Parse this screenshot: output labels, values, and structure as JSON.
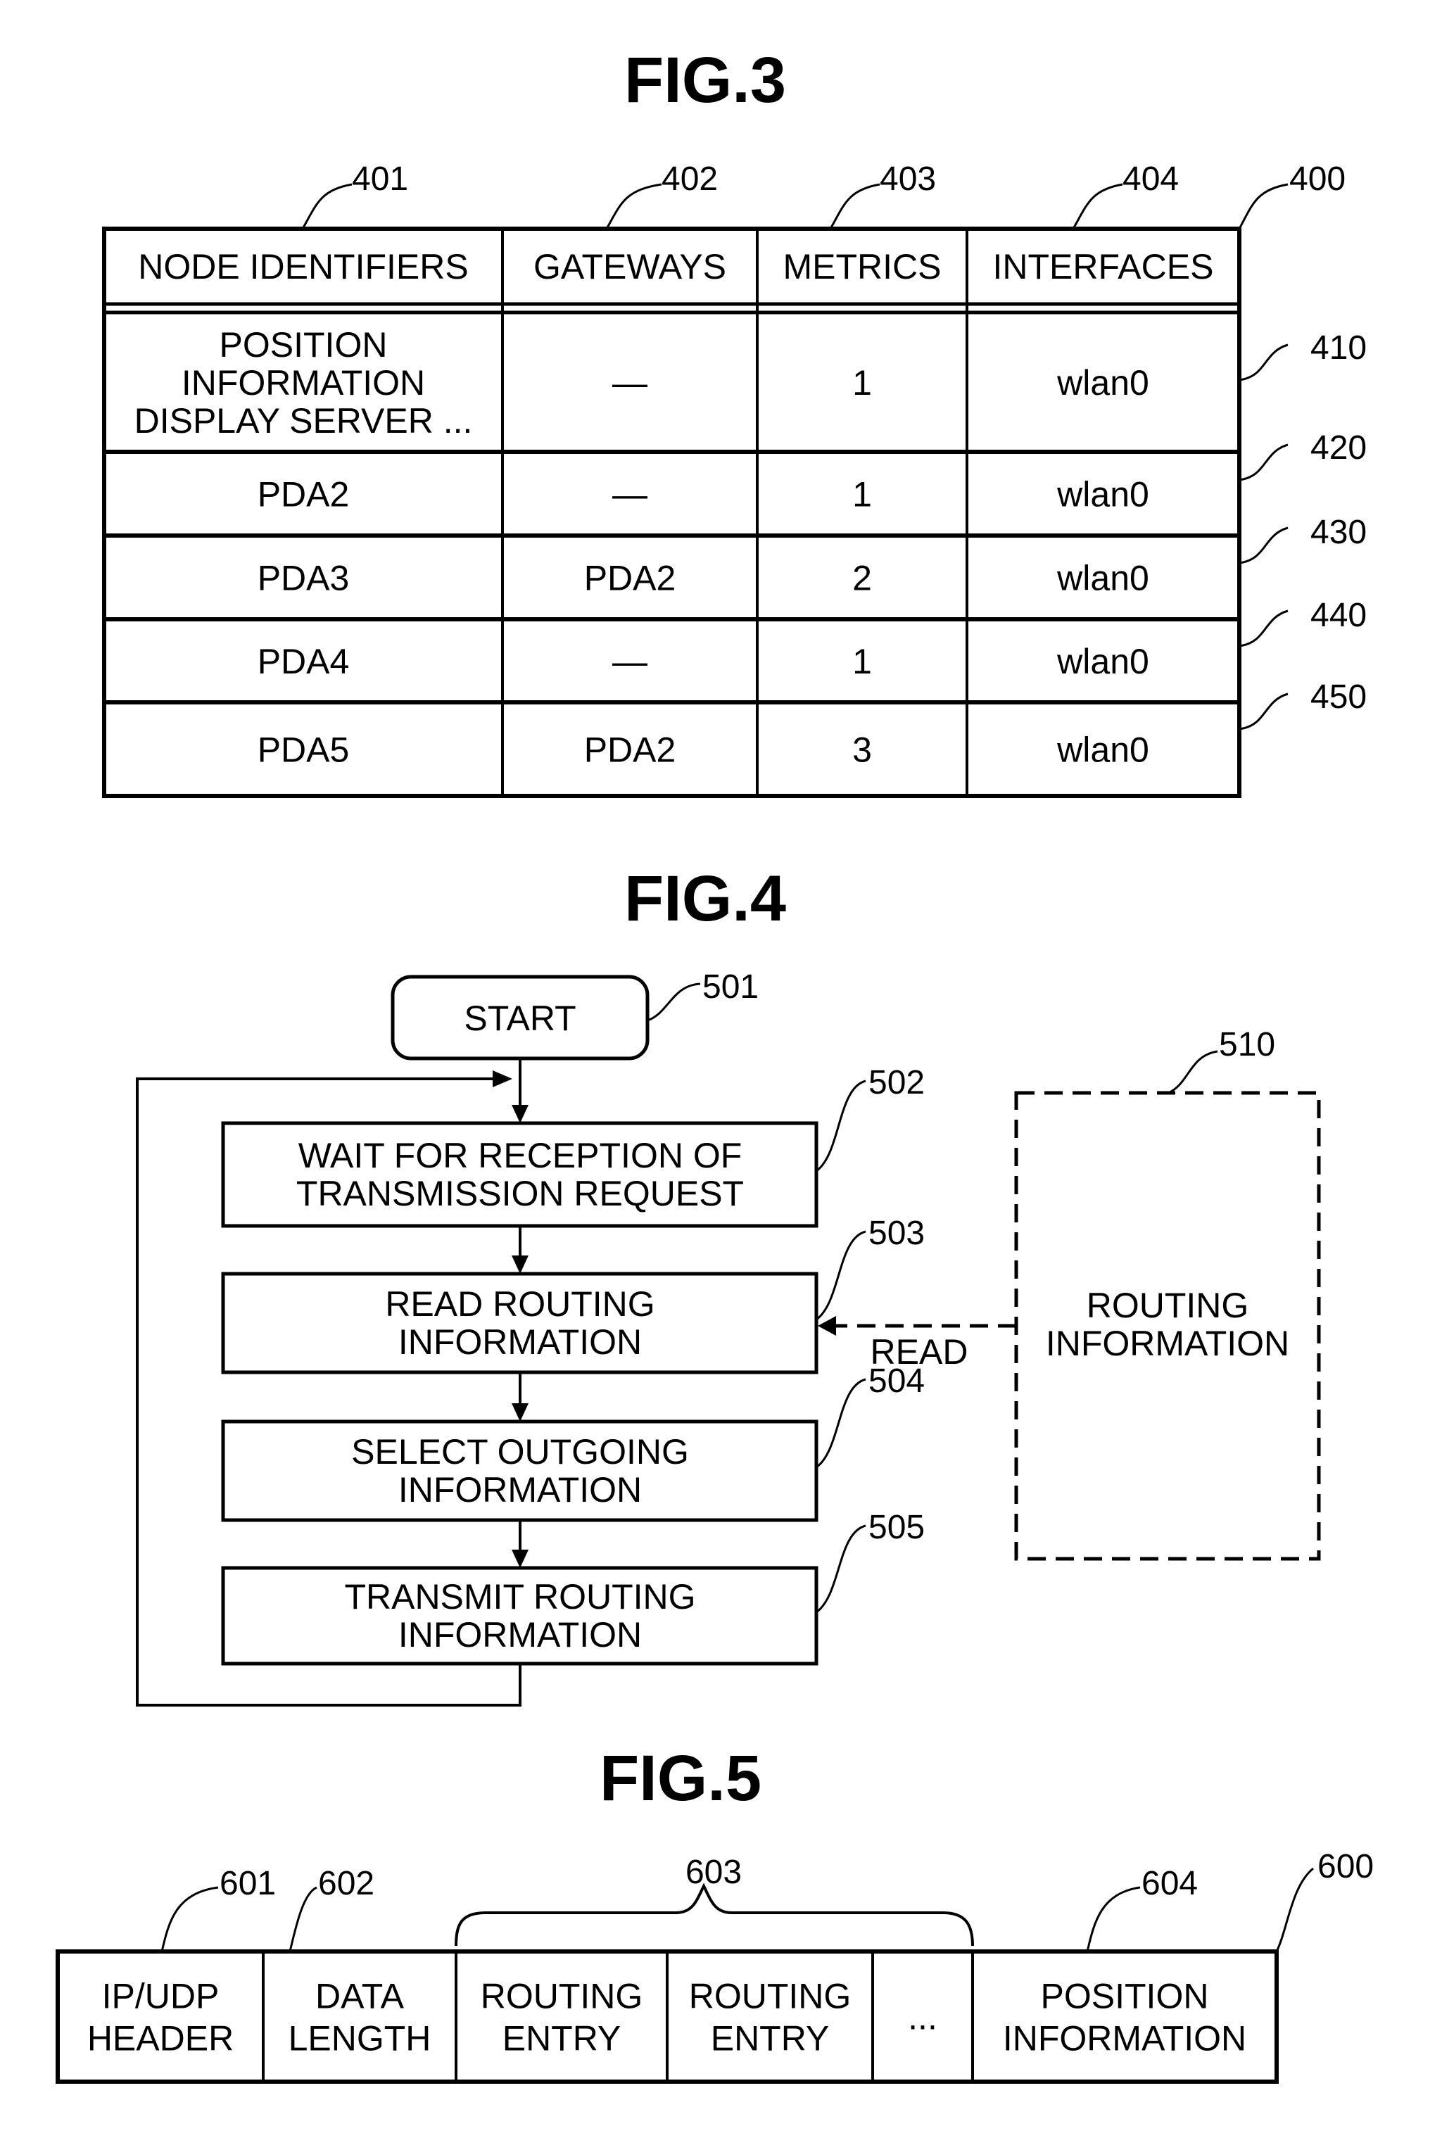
{
  "fig3": {
    "title": "FIG.3",
    "table_ref": "400",
    "columns": [
      {
        "label": "NODE IDENTIFIERS",
        "ref": "401"
      },
      {
        "label": "GATEWAYS",
        "ref": "402"
      },
      {
        "label": "METRICS",
        "ref": "403"
      },
      {
        "label": "INTERFACES",
        "ref": "404"
      }
    ],
    "rows": [
      {
        "ref": "410",
        "node": [
          "POSITION",
          "INFORMATION",
          "DISPLAY SERVER ..."
        ],
        "gateway": "—",
        "metric": "1",
        "interface": "wlan0"
      },
      {
        "ref": "420",
        "node": [
          "PDA2"
        ],
        "gateway": "—",
        "metric": "1",
        "interface": "wlan0"
      },
      {
        "ref": "430",
        "node": [
          "PDA3"
        ],
        "gateway": "PDA2",
        "metric": "2",
        "interface": "wlan0"
      },
      {
        "ref": "440",
        "node": [
          "PDA4"
        ],
        "gateway": "—",
        "metric": "1",
        "interface": "wlan0"
      },
      {
        "ref": "450",
        "node": [
          "PDA5"
        ],
        "gateway": "PDA2",
        "metric": "3",
        "interface": "wlan0"
      }
    ]
  },
  "fig4": {
    "title": "FIG.4",
    "start": {
      "label": "START",
      "ref": "501"
    },
    "steps": [
      {
        "ref": "502",
        "lines": [
          "WAIT FOR RECEPTION OF",
          "TRANSMISSION REQUEST"
        ]
      },
      {
        "ref": "503",
        "lines": [
          "READ ROUTING",
          "INFORMATION"
        ]
      },
      {
        "ref": "504",
        "lines": [
          "SELECT OUTGOING",
          "INFORMATION"
        ]
      },
      {
        "ref": "505",
        "lines": [
          "TRANSMIT ROUTING",
          "INFORMATION"
        ]
      }
    ],
    "store": {
      "ref": "510",
      "lines": [
        "ROUTING",
        "INFORMATION"
      ]
    },
    "read_label": "READ"
  },
  "fig5": {
    "title": "FIG.5",
    "packet_ref": "600",
    "fields": [
      {
        "lines": [
          "IP/UDP",
          "HEADER"
        ],
        "ref": "601"
      },
      {
        "lines": [
          "DATA",
          "LENGTH"
        ],
        "ref": "602"
      },
      {
        "lines": [
          "ROUTING",
          "ENTRY"
        ]
      },
      {
        "lines": [
          "ROUTING",
          "ENTRY"
        ]
      },
      {
        "lines": [
          "..."
        ]
      },
      {
        "lines": [
          "POSITION",
          "INFORMATION"
        ],
        "ref": "604"
      }
    ],
    "group_ref": "603"
  }
}
